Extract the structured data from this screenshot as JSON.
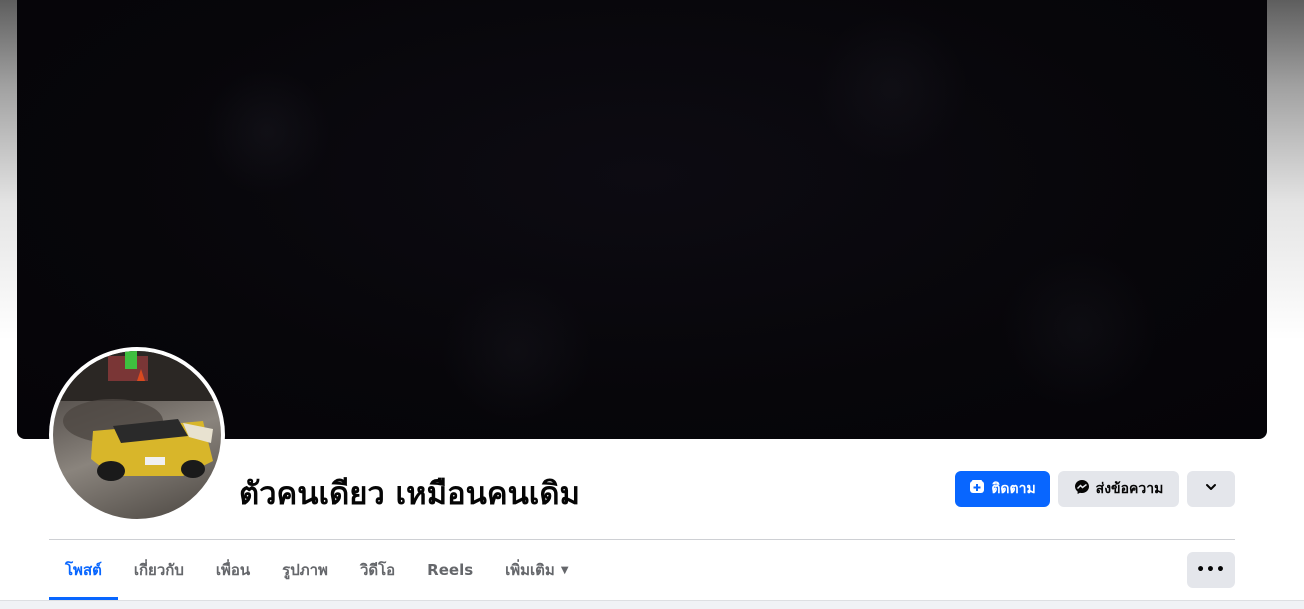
{
  "profile": {
    "name": "ตัวคนเดียว เหมือนคนเดิม"
  },
  "actions": {
    "follow_label": "ติดตาม",
    "message_label": "ส่งข้อความ",
    "dropdown_icon": "chevron-down-icon"
  },
  "tabs": [
    {
      "label": "โพสต์",
      "active": true
    },
    {
      "label": "เกี่ยวกับ",
      "active": false
    },
    {
      "label": "เพื่อน",
      "active": false
    },
    {
      "label": "รูปภาพ",
      "active": false
    },
    {
      "label": "วิดีโอ",
      "active": false
    },
    {
      "label": "Reels",
      "active": false
    },
    {
      "label": "เพิ่มเติม",
      "active": false
    }
  ],
  "more_menu_label": "•••",
  "colors": {
    "accent": "#0866ff",
    "secondary_button": "#e4e6eb",
    "text_primary": "#050505",
    "text_secondary": "#65676b",
    "cover": "#07060a"
  }
}
